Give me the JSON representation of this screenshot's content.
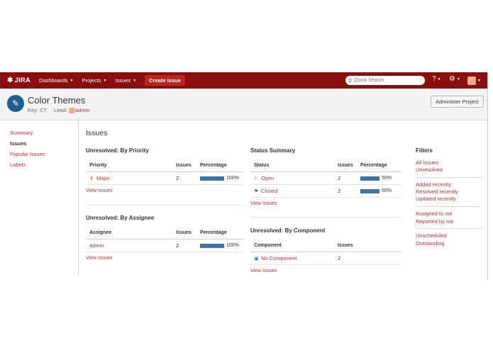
{
  "topnav": {
    "logo": "JIRA",
    "dashboards": "Dashboards",
    "projects": "Projects",
    "issues": "Issues",
    "create": "Create issue",
    "search_placeholder": "Quick Search"
  },
  "project": {
    "title": "Color Themes",
    "key_label": "Key: CT",
    "lead_label": "Lead:",
    "lead": "admin",
    "admin_button": "Administer Project"
  },
  "sidebar": {
    "items": [
      {
        "label": "Summary"
      },
      {
        "label": "Issues"
      },
      {
        "label": "Popular Issues"
      },
      {
        "label": "Labels"
      }
    ]
  },
  "main": {
    "heading": "Issues",
    "by_priority": {
      "title": "Unresolved: By Priority",
      "headers": [
        "Priority",
        "Issues",
        "Percentage"
      ],
      "rows": [
        {
          "name": "Major",
          "count": "2",
          "percent": 100,
          "percent_label": "100%"
        }
      ],
      "view": "View Issues"
    },
    "by_assignee": {
      "title": "Unresolved: By Assignee",
      "headers": [
        "Assignee",
        "Issues",
        "Percentage"
      ],
      "rows": [
        {
          "name": "admin",
          "count": "2",
          "percent": 100,
          "percent_label": "100%"
        }
      ],
      "view": "View Issues"
    },
    "status_summary": {
      "title": "Status Summary",
      "headers": [
        "Status",
        "Issues",
        "Percentage"
      ],
      "rows": [
        {
          "name": "Open",
          "count": "2",
          "percent": 50,
          "percent_label": "50%"
        },
        {
          "name": "Closed",
          "count": "2",
          "percent": 50,
          "percent_label": "50%"
        }
      ],
      "view": "View Issues"
    },
    "by_component": {
      "title": "Unresolved: By Component",
      "headers": [
        "Component",
        "Issues"
      ],
      "rows": [
        {
          "name": "No Component",
          "count": "2"
        }
      ],
      "view": "View Issues"
    }
  },
  "filters": {
    "title": "Filters",
    "groups": [
      [
        "All Issues",
        "Unresolved"
      ],
      [
        "Added recently",
        "Resolved recently",
        "Updated recently"
      ],
      [
        "Assigned to me",
        "Reported by me"
      ],
      [
        "Unscheduled",
        "Outstanding"
      ]
    ]
  },
  "colors": {
    "nav_bg": "#8b0e0e",
    "link": "#b8312f",
    "bar": "#3b73af"
  }
}
